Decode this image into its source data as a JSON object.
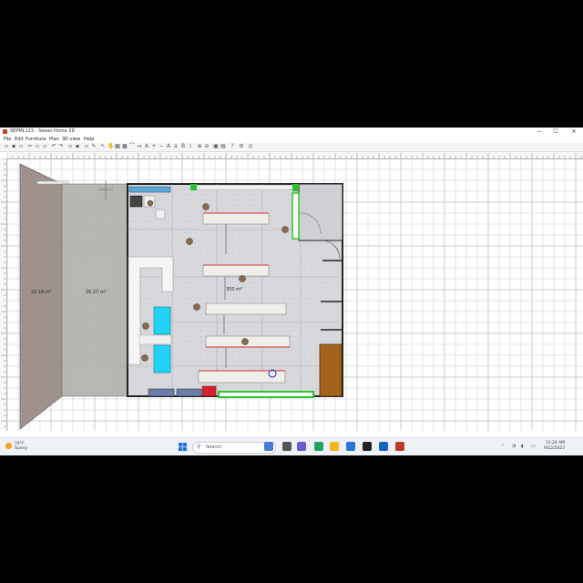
{
  "window": {
    "title": "SEPML123 - Sweet Home 3D",
    "controls": {
      "minimize": "—",
      "maximize": "☐",
      "close": "✕"
    }
  },
  "menu": [
    "File",
    "Edit",
    "Furniture",
    "Plan",
    "3D view",
    "Help"
  ],
  "plan": {
    "room_labels": [
      "22.16 m²",
      "20.27 m²",
      "350 m²"
    ],
    "colors": {
      "hatch_room": "#a79a94",
      "concrete_room": "#b9b7b3",
      "floor": "#d8d8dc",
      "walls": "#222222",
      "highlight_green": "#29c429",
      "cyan_fixture": "#22d3f5",
      "door_brown": "#a3631c",
      "red_item": "#d3202a"
    }
  },
  "taskbar": {
    "weather_temp": "74°F",
    "weather_text": "Sunny",
    "search_placeholder": "Search",
    "tray_time": "11:24 AM",
    "tray_date": "9/12/2023"
  }
}
